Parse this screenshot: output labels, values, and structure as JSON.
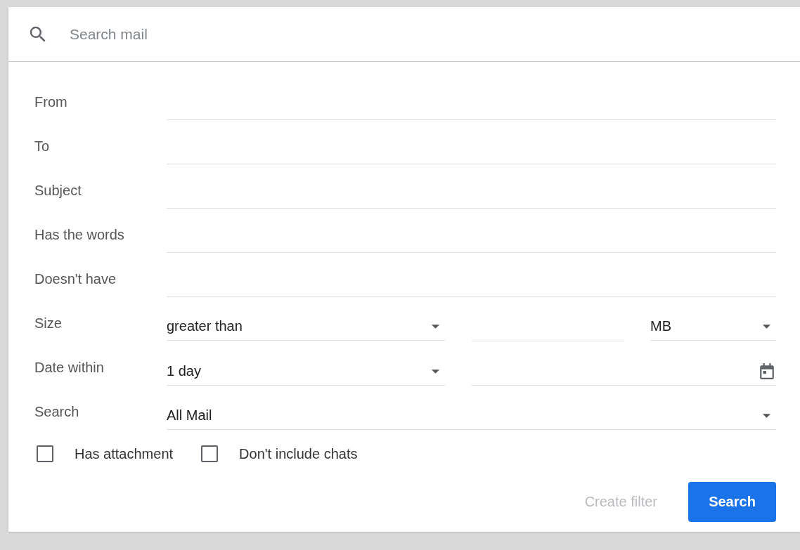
{
  "search": {
    "placeholder": "Search mail"
  },
  "fields": [
    {
      "label": "From",
      "kind": "text"
    },
    {
      "label": "To",
      "kind": "text"
    },
    {
      "label": "Subject",
      "kind": "text"
    },
    {
      "label": "Has the words",
      "kind": "text"
    },
    {
      "label": "Doesn't have",
      "kind": "text"
    },
    {
      "label": "Size",
      "kind": "size",
      "operator": "greater than",
      "unit": "MB"
    },
    {
      "label": "Date within",
      "kind": "date",
      "range": "1 day"
    },
    {
      "label": "Search",
      "kind": "select",
      "value": "All Mail"
    }
  ],
  "checkboxes": [
    {
      "label": "Has attachment",
      "checked": false
    },
    {
      "label": "Don't include chats",
      "checked": false
    }
  ],
  "buttons": [
    {
      "label": "Create filter",
      "kind": "text",
      "disabled": true
    },
    {
      "label": "Search",
      "kind": "primary",
      "disabled": false
    }
  ]
}
